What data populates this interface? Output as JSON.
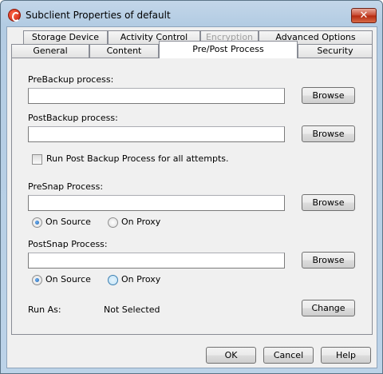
{
  "window": {
    "title": "Subclient Properties of default",
    "close_glyph": "✕"
  },
  "tabs": {
    "row1": [
      "Storage Device",
      "Activity Control",
      "Encryption",
      "Advanced Options"
    ],
    "row2": [
      "General",
      "Content",
      "Pre/Post Process",
      "Security"
    ],
    "active": "Pre/Post Process",
    "disabled": "Encryption"
  },
  "form": {
    "prebackup_label": "PreBackup process:",
    "prebackup_value": "",
    "postbackup_label": "PostBackup process:",
    "postbackup_value": "",
    "run_post_all_label": "Run Post Backup Process for all attempts.",
    "run_post_all_checked": false,
    "presnap_label": "PreSnap Process:",
    "presnap_value": "",
    "presnap_on_source": "On Source",
    "presnap_on_proxy": "On Proxy",
    "postsnap_label": "PostSnap Process:",
    "postsnap_value": "",
    "postsnap_on_source": "On Source",
    "postsnap_on_proxy": "On Proxy",
    "run_as_label": "Run As:",
    "run_as_value": "Not Selected",
    "browse_label": "Browse",
    "change_label": "Change"
  },
  "footer": {
    "ok": "OK",
    "cancel": "Cancel",
    "help": "Help"
  }
}
